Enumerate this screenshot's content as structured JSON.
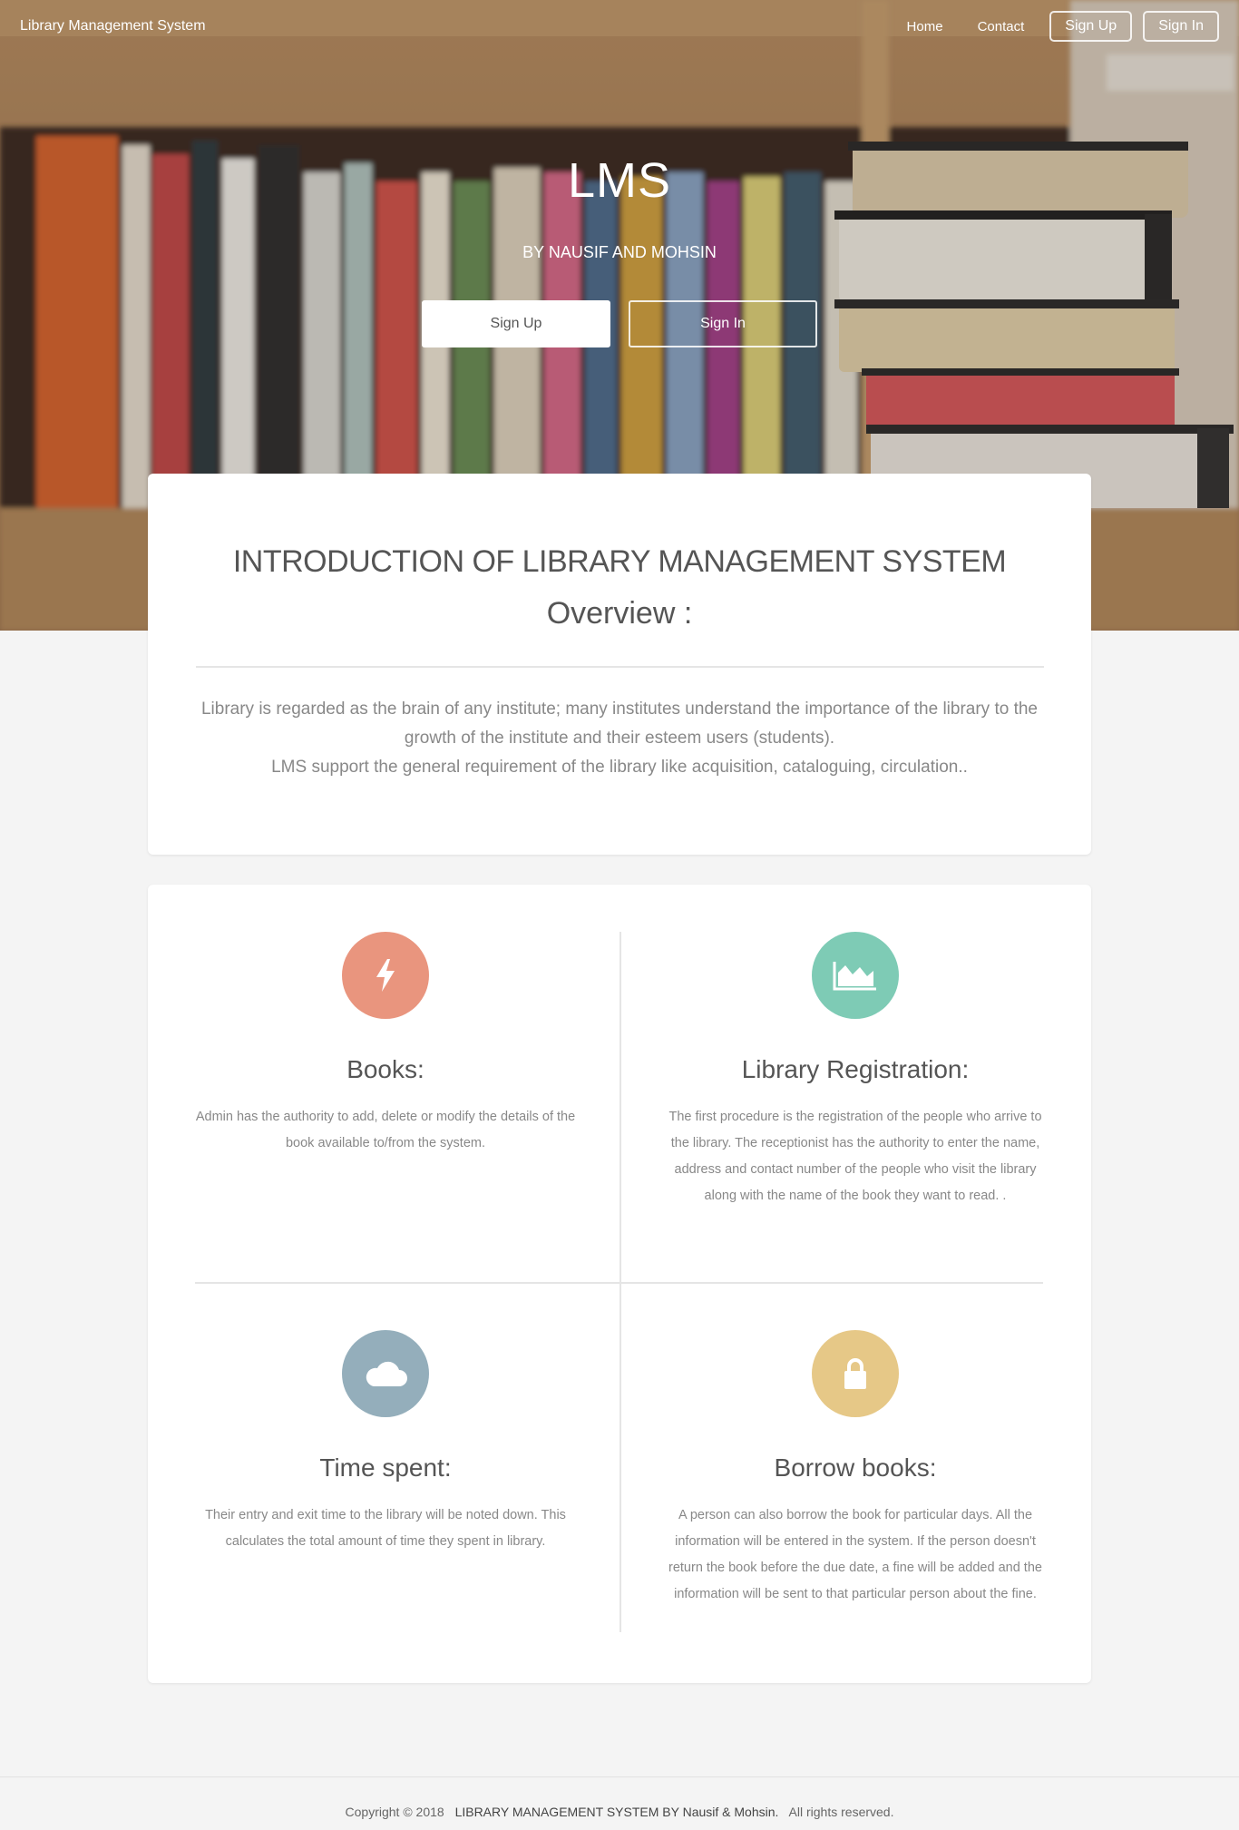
{
  "nav": {
    "brand": "Library Management System",
    "links": [
      "Home",
      "Contact"
    ],
    "signup": "Sign Up",
    "signin": "Sign In"
  },
  "hero": {
    "title": "LMS",
    "subtitle": "BY NAUSIF AND MOHSIN",
    "signup": "Sign Up",
    "signin": "Sign In"
  },
  "intro": {
    "title": "INTRODUCTION OF LIBRARY MANAGEMENT SYSTEM",
    "subtitle": "Overview :",
    "line1": "Library is regarded as the brain of any institute; many institutes understand the importance of the library to the growth of the institute and their esteem users (students).",
    "line2": "LMS support the general requirement of the library like acquisition, cataloguing, circulation.."
  },
  "features": [
    {
      "title": "Books:",
      "text": "Admin has the authority to add, delete or modify the details of the book available to/from the system.",
      "icon": "lightning-icon",
      "color": "#e9957e"
    },
    {
      "title": "Library Registration:",
      "text": "The first procedure is the registration of the people who arrive to the library. The receptionist has the authority to enter the name, address and contact number of the people who visit the library along with the name of the book they want to read. .",
      "icon": "area-chart-icon",
      "color": "#7ecbb5"
    },
    {
      "title": "Time spent:",
      "text": "Their entry and exit time to the library will be noted down. This calculates the total amount of time they spent in library.",
      "icon": "cloud-icon",
      "color": "#94aebb"
    },
    {
      "title": "Borrow books:",
      "text": "A person can also borrow the book for particular days. All the information will be entered in the system. If the person doesn't return the book before the due date, a fine will be added and the information will be sent to that particular person about the fine.",
      "icon": "lock-icon",
      "color": "#e6c887"
    }
  ],
  "footer": {
    "copyright": "Copyright © 2018",
    "name": "LIBRARY MANAGEMENT SYSTEM BY Nausif & Mohsin.",
    "rights": "All rights reserved."
  }
}
